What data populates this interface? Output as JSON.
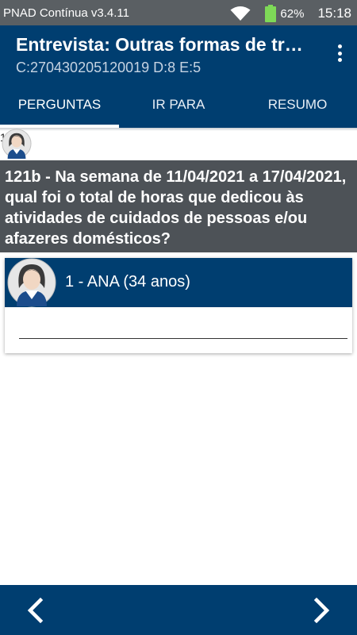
{
  "status_bar": {
    "app_name": "PNAD Contínua v3.4.11",
    "battery": "62%",
    "time": "15:18"
  },
  "app_bar": {
    "title": "Entrevista: Outras formas de trabalho",
    "subtitle": "C:270430205120019 D:8 E:5"
  },
  "tabs": [
    {
      "label": "PERGUNTAS",
      "active": true
    },
    {
      "label": "IR PARA",
      "active": false
    },
    {
      "label": "RESUMO",
      "active": false
    }
  ],
  "question": {
    "number_prefix": "1",
    "text": "121b - Na semana de 11/04/2021 a 17/04/2021, qual foi o total de horas que dedicou às atividades de cuidados de pessoas e/ou afazeres domésticos?"
  },
  "person": {
    "name": "1 - ANA (34 anos)",
    "answer_value": ""
  },
  "icons": {
    "wifi": "wifi-icon",
    "battery": "battery-icon",
    "menu": "more-vert-icon",
    "avatar": "female-avatar-icon",
    "prev": "chevron-left-icon",
    "next": "chevron-right-icon"
  },
  "colors": {
    "primary": "#003e70",
    "status_bar": "#5a5f63",
    "question_bg": "#4d5257",
    "battery": "#7ed957"
  }
}
